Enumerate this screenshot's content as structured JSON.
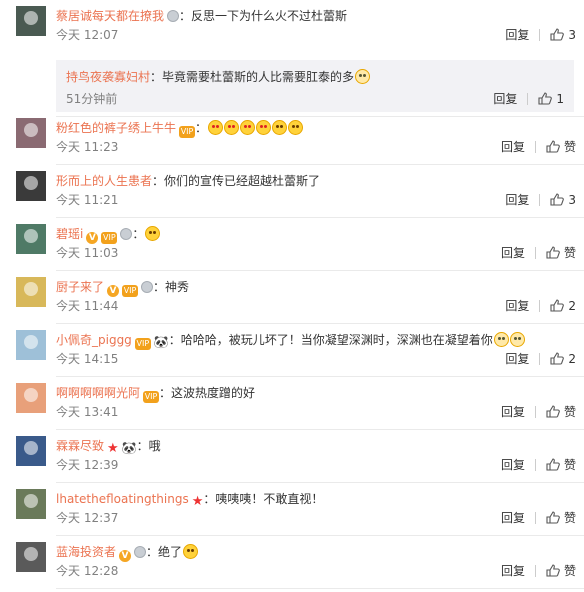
{
  "labels": {
    "reply": "回复",
    "like": "赞"
  },
  "comments": [
    {
      "user": "蔡居诚每天都在撩我",
      "badges": [
        "medal"
      ],
      "text": "：反思一下为什么火不过杜蕾斯",
      "emojis": [],
      "time": "今天 12:07",
      "likes": "3",
      "avatar_color": "#4a5a52",
      "replies": [
        {
          "user": "持鸟夜袭寡妇村",
          "text": "：毕竟需要杜蕾斯的人比需要肛泰的多",
          "emojis": [
            "cat"
          ],
          "time": "51分钟前",
          "likes": "1"
        }
      ]
    },
    {
      "user": "粉红色的裤子绣上牛牛",
      "badges": [
        "vip"
      ],
      "text": "：",
      "emojis": [
        "love",
        "love",
        "love",
        "love",
        "laugh",
        "laugh"
      ],
      "time": "今天 11:23",
      "likes": "赞",
      "avatar_color": "#8a6a72"
    },
    {
      "user": "形而上的人生患者",
      "badges": [],
      "text": "：你们的宣传已经超越杜蕾斯了",
      "emojis": [],
      "time": "今天 11:21",
      "likes": "3",
      "avatar_color": "#3a3a3a"
    },
    {
      "user": "碧瑶i",
      "badges": [
        "v",
        "vip",
        "medal"
      ],
      "text": "：",
      "emojis": [
        "laugh"
      ],
      "time": "今天 11:03",
      "likes": "赞",
      "avatar_color": "#4f7a66"
    },
    {
      "user": "厨子来了",
      "badges": [
        "v",
        "vip",
        "medal"
      ],
      "text": "：神秀",
      "emojis": [],
      "time": "今天 11:44",
      "likes": "2",
      "avatar_color": "#d8b85a"
    },
    {
      "user": "小佩奇_piggg",
      "badges": [
        "vip",
        "panda"
      ],
      "text": "：哈哈哈，被玩儿坏了！当你凝望深渊时，深渊也在凝望着你",
      "emojis": [
        "cat",
        "cat"
      ],
      "time": "今天 14:15",
      "likes": "2",
      "avatar_color": "#9ec0d8"
    },
    {
      "user": "啊啊啊啊啊光阿",
      "badges": [
        "vip"
      ],
      "text": "：这波热度蹭的好",
      "emojis": [],
      "time": "今天 13:41",
      "likes": "赞",
      "avatar_color": "#e8a07a"
    },
    {
      "user": "霖霖尽致",
      "badges": [
        "star",
        "panda"
      ],
      "text": "：哦",
      "emojis": [],
      "time": "今天 12:39",
      "likes": "赞",
      "avatar_color": "#3a5a8a"
    },
    {
      "user": "lhatethefloatingthings",
      "badges": [
        "star"
      ],
      "text": "：咦咦咦！不敢直视！",
      "emojis": [],
      "time": "今天 12:37",
      "likes": "赞",
      "avatar_color": "#6a7a5a"
    },
    {
      "user": "蓝海投资者",
      "badges": [
        "v",
        "medal"
      ],
      "text": "：绝了",
      "emojis": [
        "laugh"
      ],
      "time": "今天 12:28",
      "likes": "赞",
      "avatar_color": "#5a5a5a"
    }
  ]
}
